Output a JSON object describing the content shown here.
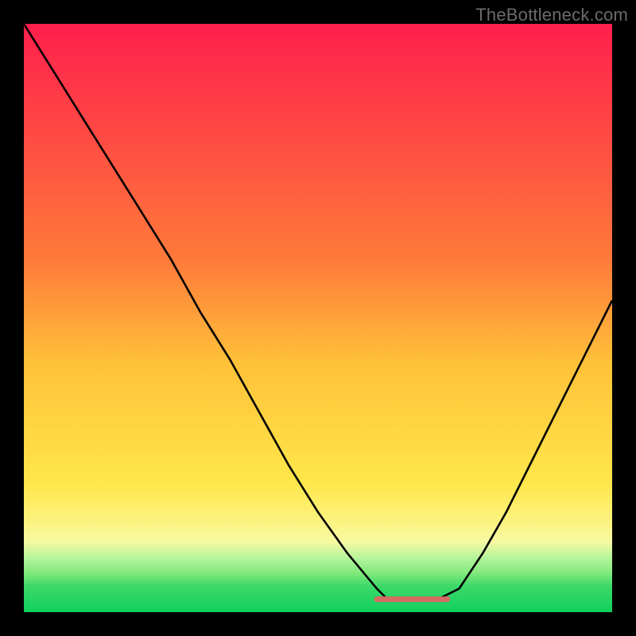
{
  "watermark": "TheBottleneck.com",
  "colors": {
    "frame_bg": "#000000",
    "curve_stroke": "#000000",
    "flat_marker": "#d66a63",
    "grad_top": "#ff1f4d",
    "grad_yellow_light": "#fdf27a",
    "grad_yellow": "#ffe64a",
    "grad_yellow_pale": "#f8f9a2",
    "grad_green_light": "#b0f49b",
    "grad_green_band_top": "#7ee87a",
    "grad_green_band_bot": "#3ed96a",
    "grad_bottom": "#0fd05c"
  },
  "chart_data": {
    "type": "line",
    "title": "",
    "xlabel": "",
    "ylabel": "",
    "xlim": [
      0,
      100
    ],
    "ylim": [
      0,
      100
    ],
    "note": "Values estimated from pixel positions on an unlabeled heat-gradient plot; y is vertical position where 0 = bottom, 100 = top.",
    "series": [
      {
        "name": "curve",
        "x": [
          0,
          5,
          10,
          15,
          20,
          25,
          30,
          35,
          40,
          45,
          50,
          55,
          60,
          62,
          65,
          68,
          70,
          74,
          78,
          82,
          86,
          90,
          94,
          98,
          100
        ],
        "y": [
          100,
          92,
          84,
          76,
          68,
          60,
          51,
          43,
          34,
          25,
          17,
          10,
          4,
          2,
          2,
          2,
          2,
          4,
          10,
          17,
          25,
          33,
          41,
          49,
          53
        ]
      },
      {
        "name": "flat-marker",
        "x": [
          60,
          72
        ],
        "y": [
          2.2,
          2.2
        ]
      }
    ]
  }
}
